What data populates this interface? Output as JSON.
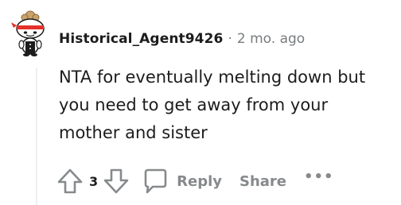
{
  "comment": {
    "author": "Historical_Agent9426",
    "separator": "·",
    "age": "2 mo. ago",
    "body_lines": [
      "NTA for eventually melting down but",
      "you need to get away from your",
      "mother and sister"
    ],
    "score": "3"
  },
  "actions": {
    "reply_label": "Reply",
    "share_label": "Share",
    "more_label": "•••"
  },
  "icons": {
    "avatar": "snoo-avatar-icon",
    "upvote": "arrow-up-icon",
    "downvote": "arrow-down-icon",
    "reply": "speech-bubble-icon"
  },
  "colors": {
    "text": "#1c1c1c",
    "meta": "#787c7e",
    "action": "#878a8c",
    "thread_line": "#edeff1",
    "avatar_bandana": "#e4322b"
  }
}
